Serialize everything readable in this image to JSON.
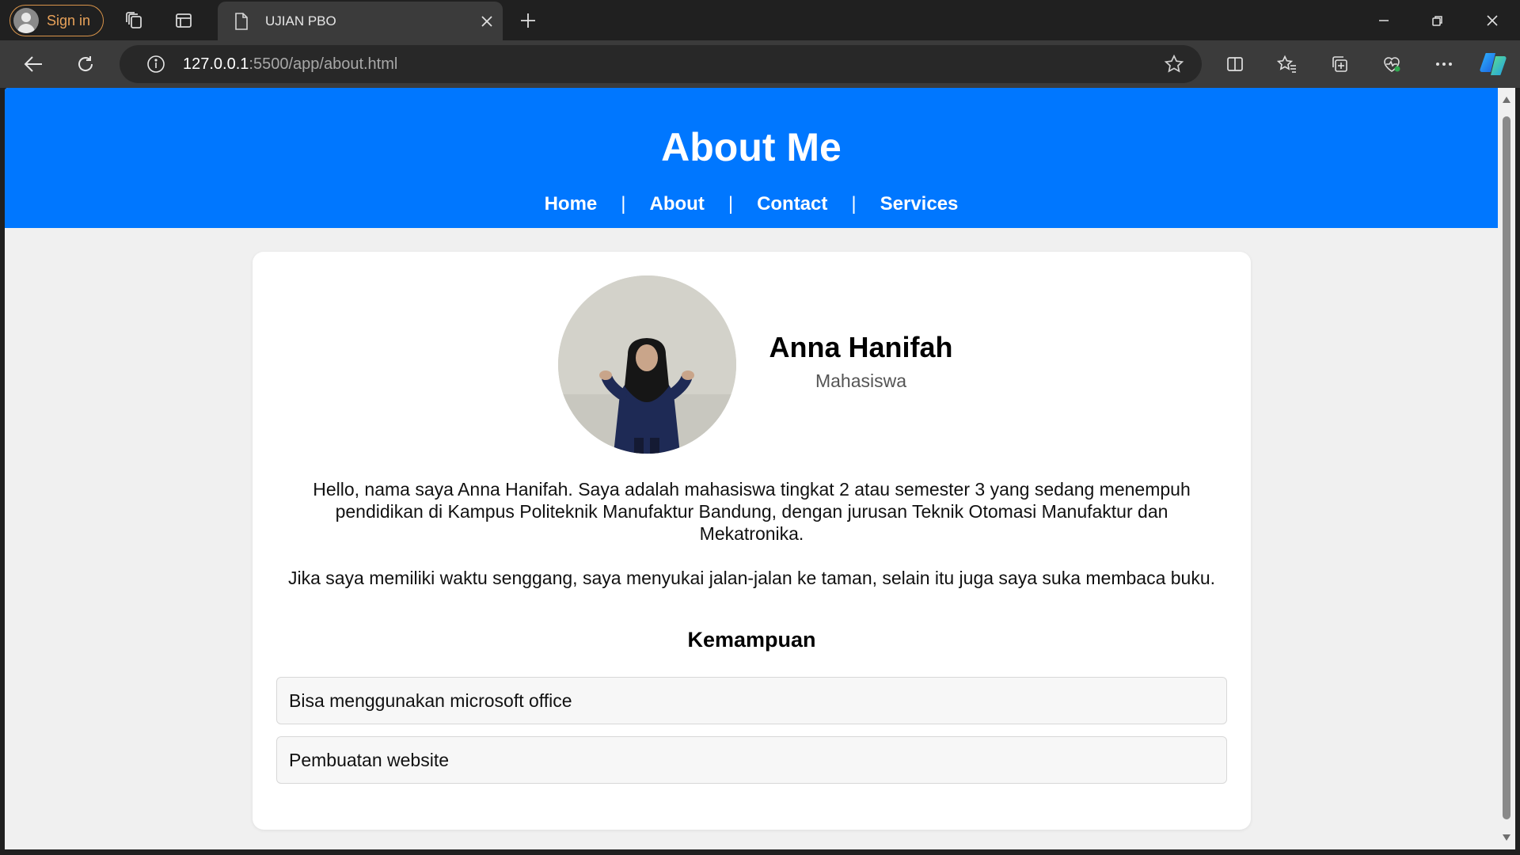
{
  "browser": {
    "profile_label": "Sign in",
    "tab_title": "UJIAN PBO",
    "url_host": "127.0.0.1",
    "url_rest": ":5500/app/about.html"
  },
  "page": {
    "header_title": "About Me",
    "nav": {
      "home": "Home",
      "about": "About",
      "contact": "Contact",
      "services": "Services",
      "separator": "|"
    },
    "profile": {
      "name": "Anna Hanifah",
      "role": "Mahasiswa"
    },
    "bio": [
      "Hello, nama saya Anna Hanifah. Saya adalah mahasiswa tingkat 2 atau semester 3 yang sedang menempuh pendidikan di Kampus Politeknik Manufaktur Bandung, dengan jurusan Teknik Otomasi Manufaktur dan Mekatronika.",
      "Jika saya memiliki waktu senggang, saya menyukai jalan-jalan ke taman, selain itu juga saya suka membaca buku."
    ],
    "skills_title": "Kemampuan",
    "skills": [
      "Bisa menggunakan microsoft office",
      "Pembuatan website"
    ]
  },
  "colors": {
    "header_blue": "#0077ff",
    "page_background": "#f0f0f0",
    "profile_accent": "#e8a25a"
  }
}
